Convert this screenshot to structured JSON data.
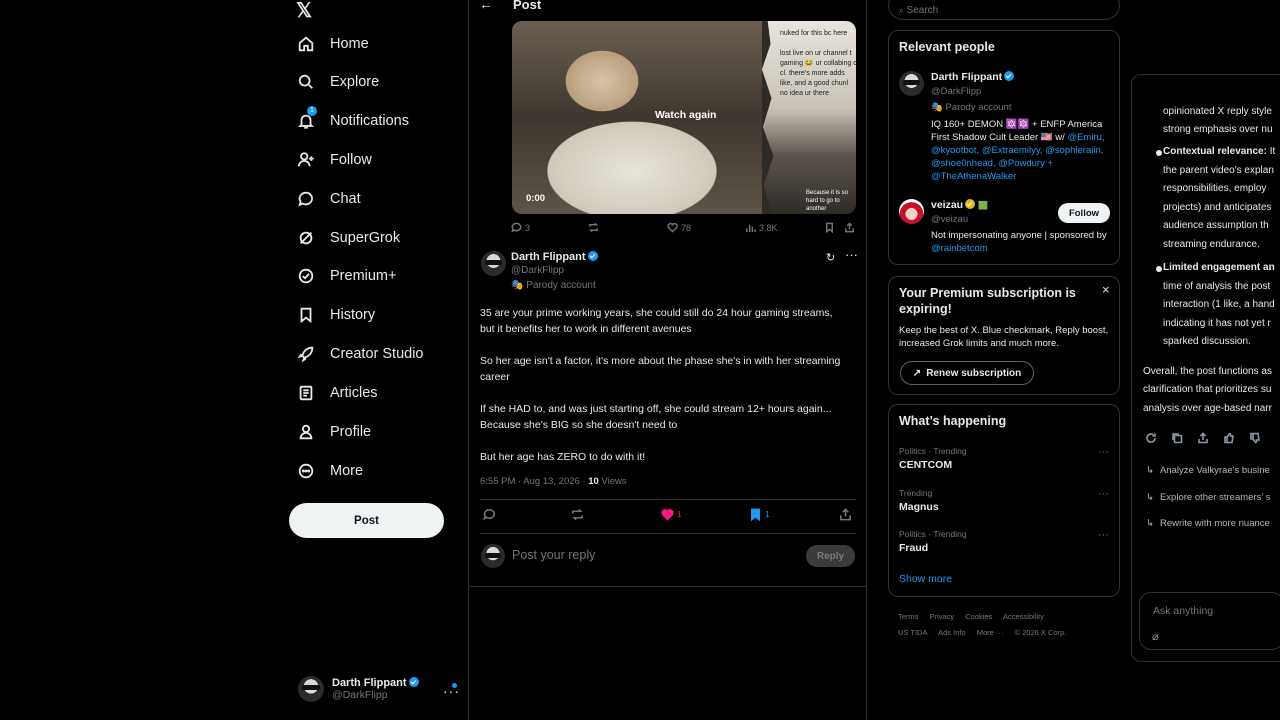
{
  "nav": {
    "logo": "𝕏",
    "items": [
      {
        "label": "Home",
        "icon": "home-icon"
      },
      {
        "label": "Explore",
        "icon": "search-icon"
      },
      {
        "label": "Notifications",
        "icon": "bell-icon"
      },
      {
        "label": "Follow",
        "icon": "follow-icon"
      },
      {
        "label": "Chat",
        "icon": "chat-icon"
      },
      {
        "label": "SuperGrok",
        "icon": "grok-icon"
      },
      {
        "label": "Premium+",
        "icon": "premium-icon"
      },
      {
        "label": "History",
        "icon": "bookmark-icon"
      },
      {
        "label": "Creator Studio",
        "icon": "rocket-icon"
      },
      {
        "label": "Articles",
        "icon": "article-icon"
      },
      {
        "label": "Profile",
        "icon": "profile-icon"
      },
      {
        "label": "More",
        "icon": "more-icon"
      }
    ],
    "notification_badge": "1",
    "post_button": "Post",
    "account": {
      "name": "Darth Flippant",
      "handle": "@DarkFlipp"
    }
  },
  "main": {
    "header_title": "Post",
    "video": {
      "watch_again": "Watch again",
      "time": "0:00",
      "overlay_top": "nuked for this bc here\n\nlost live on ur channel t\ngaming 😂 ur collabing c\ncl. there's more adds\nlike, and a good chunl\nno idea ur there",
      "overlay_bottom": "Because it is so\nhard to go to another"
    },
    "quoted_stats": {
      "replies": "3",
      "reposts": "",
      "likes": "78",
      "views": "3.8K"
    },
    "author": {
      "name": "Darth Flippant",
      "handle": "@DarkFlipp",
      "parody": "Parody account"
    },
    "paragraphs": [
      "35 are your prime working years, she could still do 24 hour gaming streams, but it benefits her to work in different avenues",
      "So her age isn't a factor, it's more about the phase she's in with her streaming career",
      "If she HAD to, and was just starting off, she could stream 12+ hours again... Because she's BIG so she doesn't need to",
      "But her age has ZERO to do with it!"
    ],
    "meta": {
      "time": "6:55 PM · Aug 13, 2026 · ",
      "views_count": "10",
      "views_label": " Views"
    },
    "actions": {
      "likes": "1",
      "bookmarks": "1"
    },
    "reply": {
      "placeholder": "Post your reply",
      "button": "Reply"
    }
  },
  "right": {
    "search_placeholder": "Search",
    "relevant": {
      "title": "Relevant people",
      "people": [
        {
          "name": "Darth Flippant",
          "handle": "@DarkFlipp",
          "tag": "Parody account",
          "bio_pre": "IQ 160+ DEMON 🔯🔯 + ENFP America First Shadow Cult Leader 🇺🇸 w/ ",
          "bio_links": "@Emiru, @kyootbot, @Extraemilyy, @sophieraiin, @shoe0nhead, @Powdury + @TheAthenaWalker"
        },
        {
          "name": "veizau",
          "handle": "@veizau",
          "bio_pre": "Not impersonating anyone | sponsored by ",
          "bio_links": "@rainbetcom",
          "follow": "Follow"
        }
      ]
    },
    "premium": {
      "title": "Your Premium subscription is expiring!",
      "body": "Keep the best of X. Blue checkmark, Reply boost, increased Grok limits and much more.",
      "button": "Renew subscription"
    },
    "happening": {
      "title": "What’s happening",
      "trends": [
        {
          "context": "Politics · Trending",
          "name": "CENTCOM"
        },
        {
          "context": "Trending",
          "name": "Magnus"
        },
        {
          "context": "Politics · Trending",
          "name": "Fraud"
        }
      ],
      "show_more": "Show more"
    },
    "footer": {
      "line1": [
        "Terms",
        "Privacy",
        "Cookies",
        "Accessibility"
      ],
      "line2": [
        "US TIDA",
        "Ads Info",
        "More ···",
        "© 2026 X Corp."
      ]
    }
  },
  "grok": {
    "lines_top": [
      "opinionated X reply style",
      "strong emphasis over nu"
    ],
    "bullet1_title": "Contextual relevance:",
    "bullet1_tail": " It",
    "bullet1_lines": [
      "the parent video's explan",
      "responsibilities, employ",
      "projects) and anticipates",
      "audience assumption th",
      "streaming endurance."
    ],
    "bullet2_title": "Limited engagement an",
    "bullet2_lines": [
      "time of analysis the post",
      "interaction (1 like, a hand",
      "indicating it has not yet r",
      "sparked discussion."
    ],
    "summary_lines": [
      "Overall, the post functions as",
      "clarification that prioritizes su",
      "analysis over age-based narr"
    ],
    "suggestions": [
      "Analyze Valkyrae's busine",
      "Explore other streamers' s",
      "Rewrite with more nuance"
    ],
    "ask_placeholder": "Ask anything"
  }
}
